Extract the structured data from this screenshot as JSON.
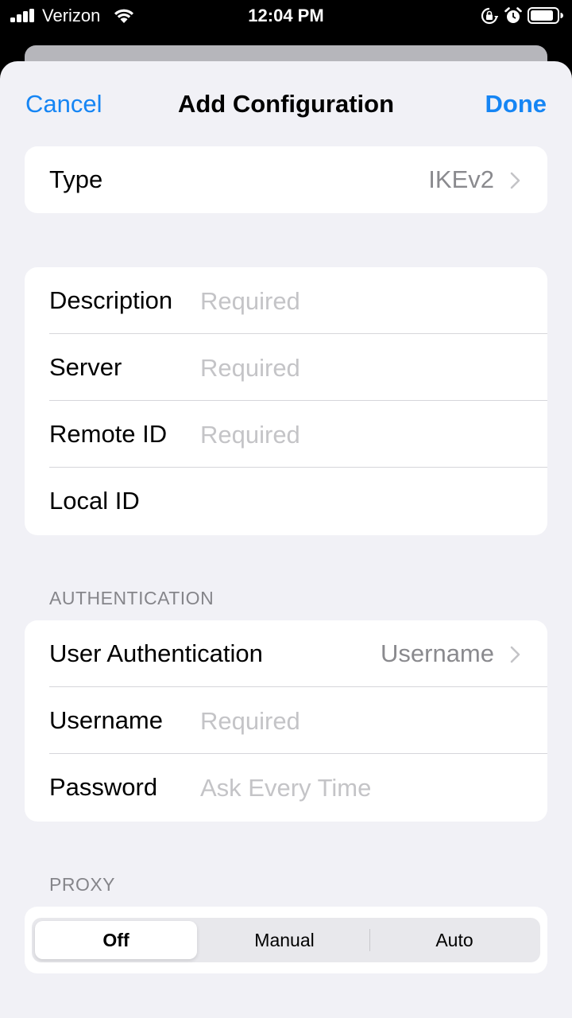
{
  "status_bar": {
    "carrier": "Verizon",
    "time": "12:04 PM",
    "signal_icon": "signal-bars-icon",
    "wifi_icon": "wifi-icon",
    "rotation_lock_icon": "rotation-lock-icon",
    "alarm_icon": "alarm-icon",
    "battery_icon": "battery-icon"
  },
  "nav": {
    "cancel": "Cancel",
    "title": "Add Configuration",
    "done": "Done"
  },
  "type_row": {
    "label": "Type",
    "value": "IKEv2"
  },
  "fields": [
    {
      "label": "Description",
      "placeholder": "Required",
      "value": ""
    },
    {
      "label": "Server",
      "placeholder": "Required",
      "value": ""
    },
    {
      "label": "Remote ID",
      "placeholder": "Required",
      "value": ""
    },
    {
      "label": "Local ID",
      "placeholder": "",
      "value": ""
    }
  ],
  "authentication": {
    "header": "AUTHENTICATION",
    "user_auth_label": "User Authentication",
    "user_auth_value": "Username",
    "username_label": "Username",
    "username_placeholder": "Required",
    "password_label": "Password",
    "password_placeholder": "Ask Every Time"
  },
  "proxy": {
    "header": "PROXY",
    "options": [
      "Off",
      "Manual",
      "Auto"
    ],
    "selected": "Off"
  },
  "colors": {
    "accent": "#1585f4",
    "background": "#f1f1f6",
    "placeholder": "#c4c4c7",
    "secondary_text": "#8a8a8e"
  }
}
